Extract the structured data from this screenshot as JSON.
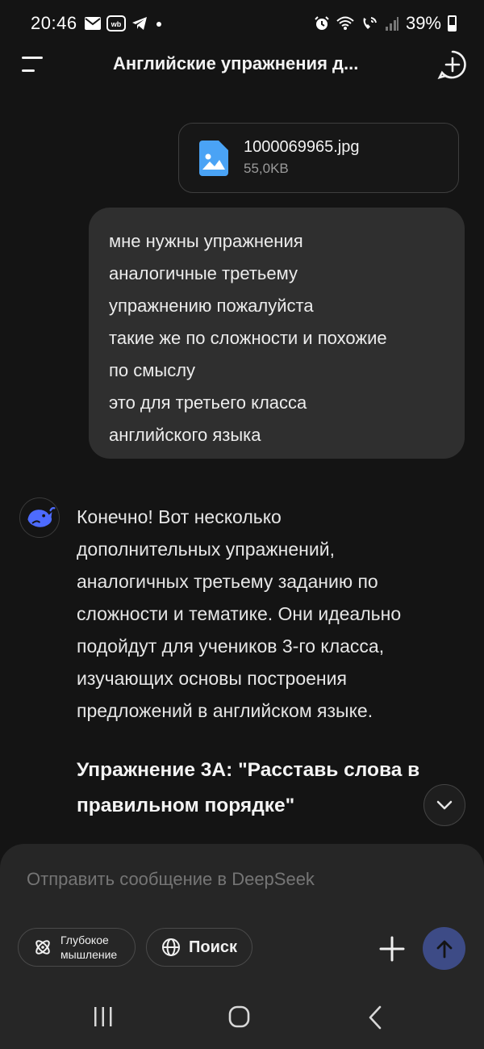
{
  "status_bar": {
    "time": "20:46",
    "battery": "39%",
    "icons": [
      "mail-icon",
      "wb-icon",
      "telegram-icon",
      "dot-icon",
      "alarm-icon",
      "wifi-icon",
      "wifi-call-icon",
      "signal-icon",
      "battery-icon"
    ]
  },
  "header": {
    "title": "Английские упражнения д...",
    "icons": [
      "menu-icon",
      "new-chat-icon"
    ]
  },
  "attachment": {
    "file_name": "1000069965.jpg",
    "file_size": "55,0KB",
    "icon": "image-file-icon",
    "accent": "#4aa3f5"
  },
  "user_message": {
    "lines": [
      "мне нужны упражнения",
      "аналогичные третьему",
      "упражнению пожалуйста",
      "такие же по сложности и похожие",
      "по смыслу",
      "это для третьего класса",
      "английского языка"
    ]
  },
  "assistant_message": {
    "avatar": "deepseek-whale-icon",
    "lines": [
      "Конечно! Вот несколько",
      "дополнительных упражнений,",
      "аналогичных третьему заданию по",
      "сложности и тематике. Они идеально",
      "подойдут для учеников 3-го класса,",
      "изучающих основы построения",
      "предложений в английском языке."
    ],
    "heading_lines": [
      "Упражнение 3А: \"Расставь слова в",
      "правильном порядке\""
    ]
  },
  "composer": {
    "placeholder": "Отправить сообщение в DeepSeek",
    "deep_think_line1": "Глубокое",
    "deep_think_line2": "мышление",
    "search_label": "Поиск",
    "send_color": "#3d4b86"
  },
  "colors": {
    "background": "#141414",
    "user_bubble": "#2f2f2f",
    "composer": "#262626",
    "accent_blue": "#4d6bfe"
  }
}
